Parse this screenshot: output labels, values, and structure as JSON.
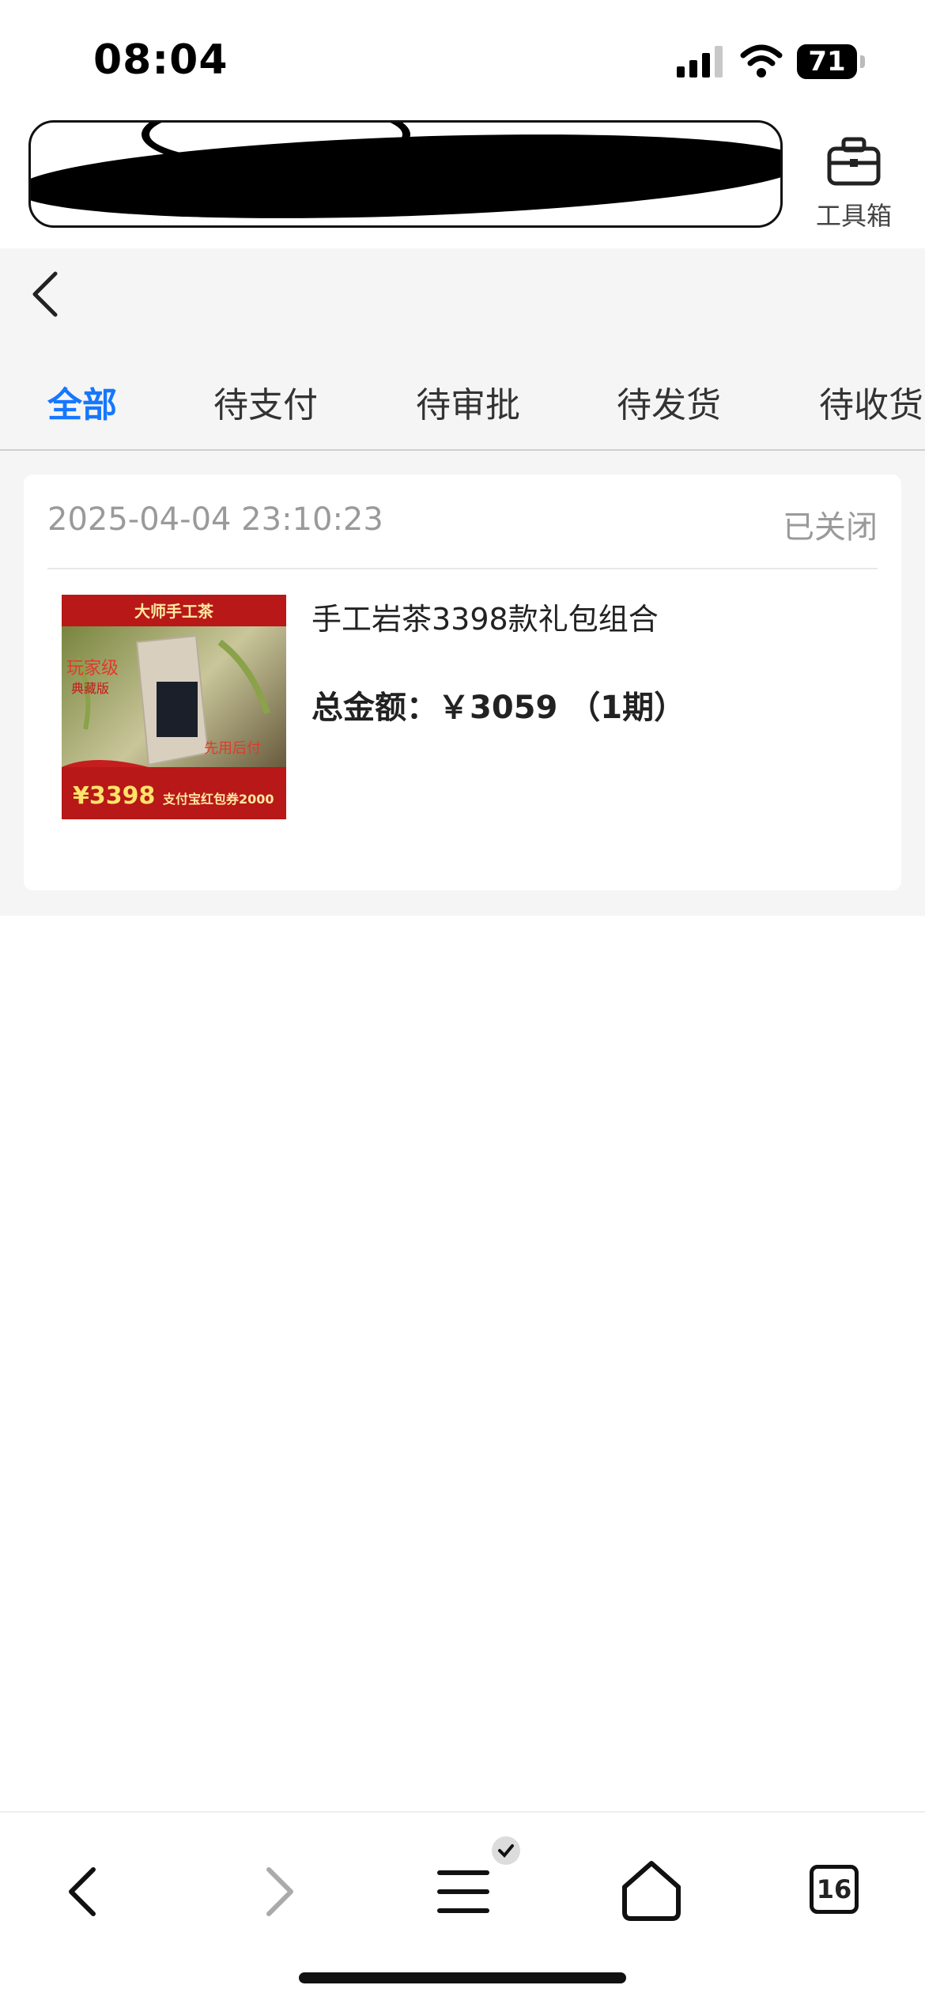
{
  "status_bar": {
    "time": "08:04",
    "battery": "71"
  },
  "toolbar": {
    "toolbox_label": "工具箱"
  },
  "tabs": [
    {
      "label": "全部",
      "active": true
    },
    {
      "label": "待支付",
      "active": false
    },
    {
      "label": "待审批",
      "active": false
    },
    {
      "label": "待发货",
      "active": false
    },
    {
      "label": "待收货",
      "active": false
    }
  ],
  "order": {
    "time": "2025-04-04 23:10:23",
    "status": "已关闭",
    "product_name": "手工岩茶3398款礼包组合",
    "total_label": "总金额：",
    "total_value": "￥3059 （1期）",
    "image": {
      "banner": "大师手工茶",
      "tag1": "玩家级",
      "tag2": "典藏版",
      "tag3": "先用后付",
      "price": "¥3398",
      "coupon": "支付宝红包券2000"
    }
  },
  "bottom_bar": {
    "tab_count": "16"
  },
  "colors": {
    "accent": "#1677ff",
    "background": "#f5f5f5",
    "muted": "#9a9a9a"
  }
}
